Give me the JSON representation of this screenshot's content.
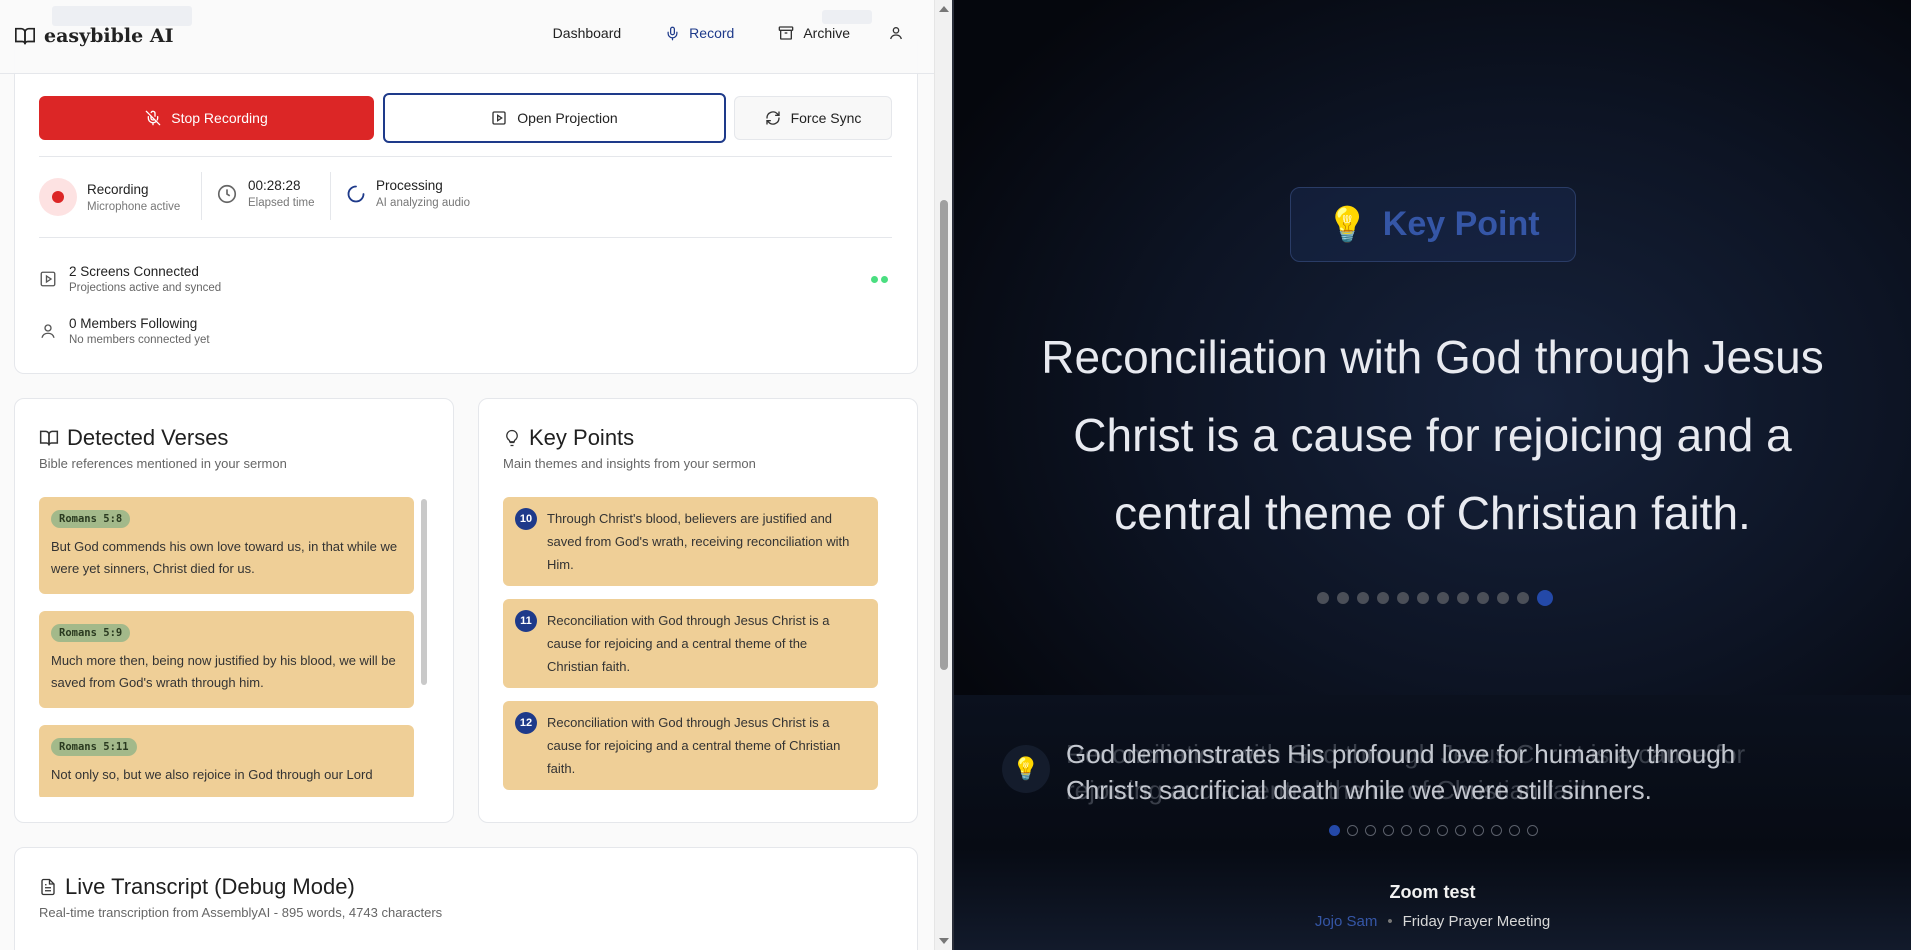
{
  "nav": {
    "brand": "easybible AI",
    "links": [
      {
        "label": "Dashboard"
      },
      {
        "label": "Record"
      },
      {
        "label": "Archive"
      }
    ]
  },
  "controls": {
    "stop_label": "Stop Recording",
    "projection_label": "Open Projection",
    "sync_label": "Force Sync"
  },
  "status": {
    "recording": {
      "title": "Recording",
      "sub": "Microphone active"
    },
    "timer": {
      "title": "00:28:28",
      "sub": "Elapsed time"
    },
    "processing": {
      "title": "Processing",
      "sub": "AI analyzing audio"
    }
  },
  "connections": {
    "screens": {
      "title": "2 Screens Connected",
      "sub": "Projections active and synced"
    },
    "members": {
      "title": "0 Members Following",
      "sub": "No members connected yet"
    }
  },
  "verses": {
    "title": "Detected Verses",
    "subtitle": "Bible references mentioned in your sermon",
    "items": [
      {
        "ref": "Romans 5:8",
        "text": "But God commends his own love toward us, in that while we were yet sinners, Christ died for us."
      },
      {
        "ref": "Romans 5:9",
        "text": "Much more then, being now justified by his blood, we will be saved from God's wrath through him."
      },
      {
        "ref": "Romans 5:11",
        "text": "Not only so, but we also rejoice in God through our Lord"
      }
    ]
  },
  "key_points": {
    "title": "Key Points",
    "subtitle": "Main themes and insights from your sermon",
    "items": [
      {
        "num": "10",
        "text": "Through Christ's blood, believers are justified and saved from God's wrath, receiving reconciliation with Him."
      },
      {
        "num": "11",
        "text": "Reconciliation with God through Jesus Christ is a cause for rejoicing and a central theme of the Christian faith."
      },
      {
        "num": "12",
        "text": "Reconciliation with God through Jesus Christ is a cause for rejoicing and a central theme of Christian faith."
      }
    ]
  },
  "transcript": {
    "title": "Live Transcript (Debug Mode)",
    "subtitle": "Real-time transcription from AssemblyAI - 895 words, 4743 characters"
  },
  "projection": {
    "badge": "Key Point",
    "main_text": "Reconciliation with God through Jesus Christ is a cause for rejoicing and a central theme of Christian faith.",
    "main_slide_count": 12,
    "main_active_index": 11,
    "lower_text_current": "God demonstrates His profound love for humanity through Christ's sacrificial death while we were still sinners.",
    "lower_text_fading": "Reconciliation with God through Jesus Christ is a cause for rejoicing and a central theme of Christian faith.",
    "lower_slide_count": 12,
    "lower_active_index": 0,
    "service_title": "Zoom test",
    "preacher": "Jojo Sam",
    "service_name": "Friday Prayer Meeting",
    "accent_color": "#2449a8"
  }
}
